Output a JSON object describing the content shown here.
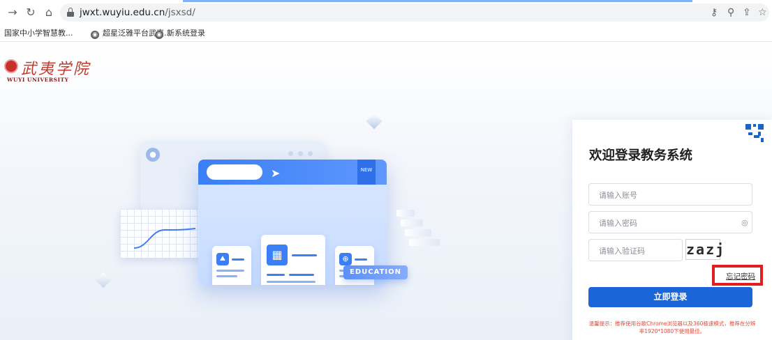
{
  "browser": {
    "url_host": "jwxt.wuyiu.edu.cn",
    "url_path": "/jsxsd/",
    "icons": [
      "back-arrow-icon",
      "reload-icon",
      "home-icon",
      "lock-icon",
      "key-icon",
      "zoom-icon",
      "share-icon",
      "star-icon"
    ]
  },
  "bookmarks": [
    {
      "label": "国家中小学智慧教..."
    },
    {
      "label": "超星泛雅平台武夷..."
    },
    {
      "label": "新系统登录"
    }
  ],
  "logo": {
    "cn": "武夷学院",
    "en": "WUYI UNIVERSITY"
  },
  "illustration": {
    "new_tag": "NEW",
    "education_badge": "EDUCATION"
  },
  "login": {
    "title": "欢迎登录教务系统",
    "account_placeholder": "请输入账号",
    "password_placeholder": "请输入密码",
    "captcha_placeholder": "请输入验证码",
    "captcha_text": "zazj",
    "forgot_password": "忘记密码",
    "submit": "立即登录",
    "tip": "温馨提示：推荐使用谷歌Chrome浏览器以及360极速模式，推荐在分辨率1920*1080下使用最佳。"
  },
  "colors": {
    "accent": "#1a66d8",
    "highlight_box": "#e02020",
    "tip_text": "#e04a3a",
    "logo": "#c0392b"
  }
}
